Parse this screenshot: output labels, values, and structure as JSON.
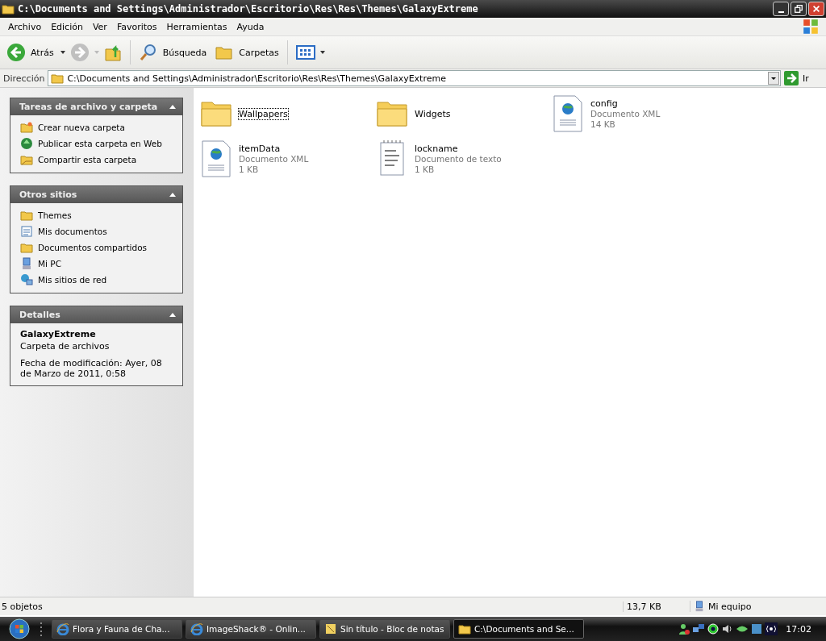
{
  "window": {
    "title": "C:\\Documents and Settings\\Administrador\\Escritorio\\Res\\Res\\Themes\\GalaxyExtreme"
  },
  "menu": [
    "Archivo",
    "Edición",
    "Ver",
    "Favoritos",
    "Herramientas",
    "Ayuda"
  ],
  "toolbar": {
    "back": "Atrás",
    "search": "Búsqueda",
    "folders": "Carpetas"
  },
  "address": {
    "label": "Dirección",
    "value": "C:\\Documents and Settings\\Administrador\\Escritorio\\Res\\Res\\Themes\\GalaxyExtreme",
    "go": "Ir"
  },
  "sidebar": [
    {
      "title": "Tareas de archivo y carpeta",
      "kind": "links",
      "items": [
        {
          "label": "Crear nueva carpeta",
          "kind": "newfolder"
        },
        {
          "label": "Publicar esta carpeta en Web",
          "kind": "globe"
        },
        {
          "label": "Compartir esta carpeta",
          "kind": "share"
        }
      ]
    },
    {
      "title": "Otros sitios",
      "kind": "links",
      "items": [
        {
          "label": "Themes",
          "kind": "folder"
        },
        {
          "label": "Mis documentos",
          "kind": "docs"
        },
        {
          "label": "Documentos compartidos",
          "kind": "folder"
        },
        {
          "label": "Mi PC",
          "kind": "pc"
        },
        {
          "label": "Mis sitios de red",
          "kind": "network"
        }
      ]
    },
    {
      "title": "Detalles",
      "kind": "details",
      "name": "GalaxyExtreme",
      "type": "Carpeta de archivos",
      "modified": "Fecha de modificación: Ayer, 08 de Marzo de 2011, 0:58"
    }
  ],
  "files": [
    {
      "name": "Wallpapers",
      "kind": "folder",
      "selected": true
    },
    {
      "name": "Widgets",
      "kind": "folder",
      "selected": false
    },
    {
      "name": "config",
      "kind": "xml",
      "type": "Documento XML",
      "size": "14 KB",
      "selected": false
    },
    {
      "name": "itemData",
      "kind": "xml",
      "type": "Documento XML",
      "size": "1 KB",
      "selected": false
    },
    {
      "name": "lockname",
      "kind": "text",
      "type": "Documento de texto",
      "size": "1 KB",
      "selected": false
    }
  ],
  "status_bar": {
    "count": "5 objetos",
    "size": "13,7 KB",
    "zone": "Mi equipo"
  },
  "taskbar": {
    "buttons": [
      {
        "label": "Flora y Fauna de Cha...",
        "kind": "ie",
        "selected": false
      },
      {
        "label": "ImageShack® - Onlin...",
        "kind": "ie",
        "selected": false
      },
      {
        "label": "Sin título - Bloc de notas",
        "kind": "notepad",
        "selected": false
      },
      {
        "label": "C:\\Documents and Se...",
        "kind": "folder",
        "selected": true
      }
    ],
    "clock": "17:02"
  }
}
